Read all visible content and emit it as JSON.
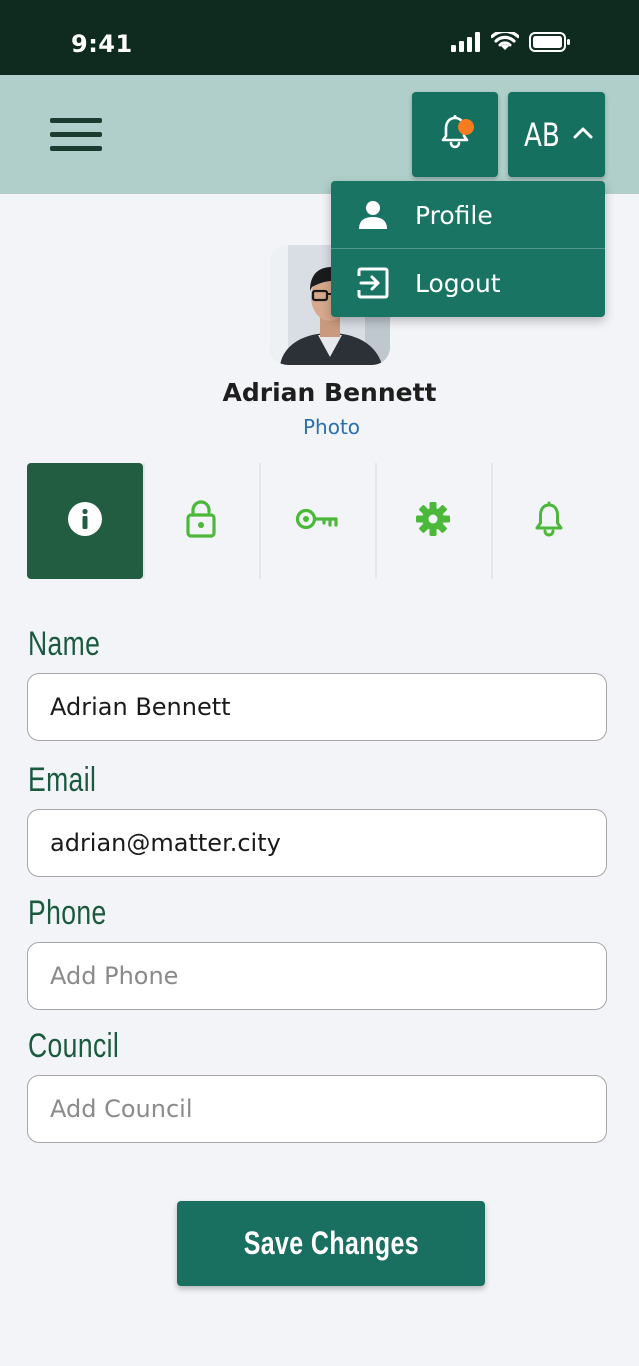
{
  "status_bar": {
    "time": "9:41"
  },
  "header": {
    "user_initials": "AB"
  },
  "dropdown": {
    "items": [
      {
        "label": "Profile",
        "icon": "person-icon"
      },
      {
        "label": "Logout",
        "icon": "logout-icon"
      }
    ]
  },
  "profile": {
    "name": "Adrian Bennett",
    "photo_link": "Photo"
  },
  "tabs": [
    {
      "icon": "info-icon",
      "active": true
    },
    {
      "icon": "lock-icon",
      "active": false
    },
    {
      "icon": "key-icon",
      "active": false
    },
    {
      "icon": "gear-icon",
      "active": false
    },
    {
      "icon": "bell-icon",
      "active": false
    }
  ],
  "form": {
    "name": {
      "label": "Name",
      "value": "Adrian Bennett",
      "placeholder": ""
    },
    "email": {
      "label": "Email",
      "value": "adrian@matter.city",
      "placeholder": ""
    },
    "phone": {
      "label": "Phone",
      "value": "",
      "placeholder": "Add Phone"
    },
    "council": {
      "label": "Council",
      "value": "",
      "placeholder": "Add Council"
    },
    "save_label": "Save Changes"
  },
  "colors": {
    "status_bar": "#0f2b20",
    "header": "#b0cfca",
    "primary_button": "#167060",
    "active_tab": "#225c41",
    "tab_icon": "#4cb83a",
    "label": "#1b5a3e",
    "notification_dot": "#f57c1f",
    "link": "#2a6fb0"
  }
}
